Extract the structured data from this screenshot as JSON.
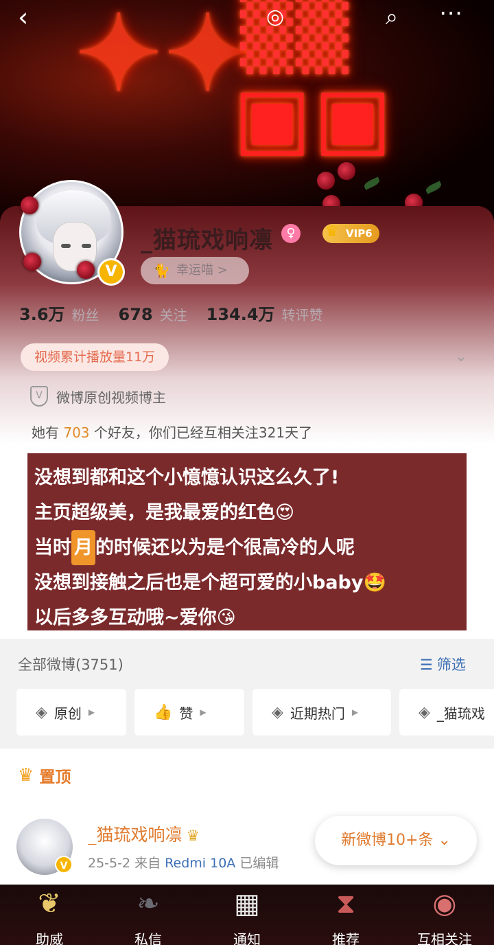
{
  "topbar": {
    "back_icon": "back-arrow-icon",
    "mascot_icon": "mascot-icon",
    "search_icon": "search-icon",
    "more_icon": "more-icon"
  },
  "banner": {
    "colors": {
      "neon": "#ff3a1a",
      "background": "#0b0000"
    }
  },
  "profile": {
    "username": "_猫琉戏响凛",
    "vip_label": "VIP6",
    "lucky_label": "幸运喵 >",
    "stats": [
      {
        "value": "3.6万",
        "label": "粉丝"
      },
      {
        "value": "678",
        "label": "关注"
      },
      {
        "value": "134.4万",
        "label": "转评赞"
      }
    ],
    "play_count": "视频累计播放量11万",
    "verified_label": "微博原创视频博主",
    "friends_prefix": "她有",
    "friends_count": "703",
    "friends_suffix": "个好友，你们已经互相关注321天了"
  },
  "bio": {
    "line1": "没想到都和这个小憶憶认识这么久了!",
    "line2": "主页超级美，是我最爱的红色😍",
    "line3_pre": "当时",
    "line3_month": "月",
    "line3_post": "的时候还以为是个很高冷的人呢",
    "line4": "没想到接触之后也是个超可爱的小baby🤩",
    "line5": "以后多多互动哦~爱你😘"
  },
  "weibo": {
    "all_label": "全部微博(3751)",
    "filter_label": "筛选",
    "chips": [
      {
        "label": "原创",
        "icon": "layers-icon"
      },
      {
        "label": "赞",
        "icon": "thumbs-up-icon"
      },
      {
        "label": "近期热门",
        "icon": "layers-icon"
      },
      {
        "label": "_猫琉戏",
        "icon": "layers-icon"
      }
    ],
    "pinned_label": "置顶",
    "post": {
      "author": "_猫琉戏响凛",
      "date": "25-5-2",
      "source_prefix": "来自",
      "device": "Redmi 10A",
      "edited": "已编辑"
    },
    "new_posts": "新微博10+条"
  },
  "tabbar": {
    "items": [
      {
        "label": "助威",
        "icon": "butterfly-frame-icon"
      },
      {
        "label": "私信",
        "icon": "raven-icon"
      },
      {
        "label": "通知",
        "icon": "chessboard-icon"
      },
      {
        "label": "推荐",
        "icon": "hourglass-icon"
      },
      {
        "label": "互相关注",
        "icon": "mirror-icon"
      }
    ]
  }
}
